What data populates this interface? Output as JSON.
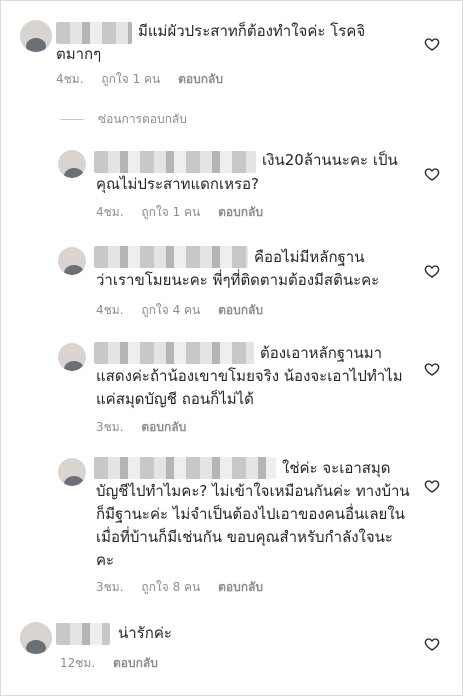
{
  "comments": [
    {
      "text_lines": [
        "มีแม่ผัวประสาทก็ต้องทำใจค่ะ โรคจิ",
        "ตมากๆ"
      ],
      "time": "4ชม.",
      "likes": "ถูกใจ 1 คน",
      "reply": "ตอบกลับ"
    },
    {
      "text_lines": [
        "เงิน20ล้านนะคะ เป็น",
        "คุณไม่ประสาทแดกเหรอ?"
      ],
      "time": "4ชม.",
      "likes": "ถูกใจ 1 คน",
      "reply": "ตอบกลับ"
    },
    {
      "text_lines": [
        "คืออไม่มีหลักฐาน",
        "ว่าเราขโมยนะคะ พี่ๆที่ติดตามต้องมีสตินะคะ"
      ],
      "time": "4ชม.",
      "likes": "ถูกใจ 4 คน",
      "reply": "ตอบกลับ"
    },
    {
      "text_lines": [
        "ต้องเอาหลักฐานมา",
        "แสดงค่ะถ้าน้องเขาขโมยจริง น้องจะเอาไปทำไม",
        "แค่สมุดบัญชี ถอนก็ไม่ได้"
      ],
      "time": "3ชม.",
      "reply": "ตอบกลับ"
    },
    {
      "text_lines": [
        "ใช่ค่ะ จะเอาสมุด",
        "บัญชีไปทำไมคะ? ไม่เข้าใจเหมือนกันค่ะ ทางบ้าน",
        "ก็มีฐานะค่ะ ไม่จำเป็นต้องไปเอาของคนอื่นเลยใน",
        "เมื่อที่บ้านก็มีเช่นกัน ขอบคุณสำหรับกำลังใจนะ",
        "คะ"
      ],
      "time": "3ชม.",
      "likes": "ถูกใจ 8 คน",
      "reply": "ตอบกลับ"
    },
    {
      "text_lines": [
        "น่ารักค่ะ"
      ],
      "time": "12ชม.",
      "reply": "ตอบกลับ"
    }
  ],
  "hide_replies_label": "ซ่อนการตอบกลับ",
  "icons": {
    "like": "heart-outline-icon"
  }
}
